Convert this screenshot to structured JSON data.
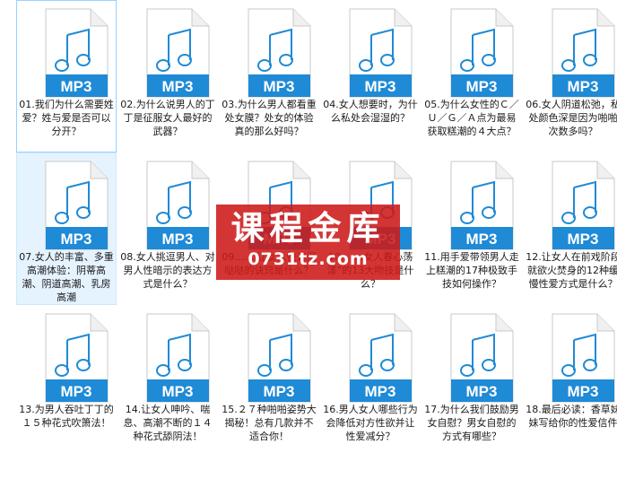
{
  "files": [
    {
      "name": "01.我们为什么需要姓爱？姓与爱是否可以分开？",
      "ext": "MP3"
    },
    {
      "name": "02.为什么说男人的丁丁是征服女人最好的武器？",
      "ext": "MP3"
    },
    {
      "name": "03.为什么男人都看重处女膜？处女的体验真的那么好吗？",
      "ext": "MP3"
    },
    {
      "name": "04.女人想要时，为什么私处会湿湿的？",
      "ext": "MP3"
    },
    {
      "name": "05.为什么女性的Ｃ／Ｕ／Ｇ／Ａ点为最易获取糕潮的４大点？",
      "ext": "MP3"
    },
    {
      "name": "06.女人阴道松弛，私处颜色深是因为啪啪次数多吗？",
      "ext": "MP3"
    },
    {
      "name": "07.女人的丰富、多重高潮体验：阴蒂高潮、阴道高潮、乳房高潮",
      "ext": "MP3"
    },
    {
      "name": "08.女人挑逗男人、对男人性暗示的表达方式是什么？",
      "ext": "MP3"
    },
    {
      "name": "09.……让女人快速湿哒哒的诀窍是什么？",
      "ext": "MP3"
    },
    {
      "name": "10.……女人春心荡漾”的13大吻技是什么？",
      "ext": "MP3"
    },
    {
      "name": "11.用手爱带领男人走上糕潮的17种极致手技如何操作？",
      "ext": "MP3"
    },
    {
      "name": "12.让女人在前戏阶段就欲火焚身的12种缓慢性爱方式是什么？",
      "ext": "MP3"
    },
    {
      "name": "13.为男人吞吐丁丁的１５种花式吹箫法！",
      "ext": "MP3"
    },
    {
      "name": "14.让女人呻吟、喘息、高潮不断的１４种花式舔阴法！",
      "ext": "MP3"
    },
    {
      "name": "15.２７种啪啪姿势大揭秘！总有几款并不适合你！",
      "ext": "MP3"
    },
    {
      "name": "16.男人女人哪些行为会降低对方性欲并让性爱减分？",
      "ext": "MP3"
    },
    {
      "name": "17.为什么我们鼓励男女自慰？男女自慰的方式有哪些？",
      "ext": "MP3"
    },
    {
      "name": "18.最后必读：香草妹妹写给你的性爱信件",
      "ext": "MP3"
    }
  ],
  "selected_index": 6,
  "focus_index": 0,
  "watermark": {
    "title": "课程金库",
    "url": "0731tz.com"
  },
  "colors": {
    "badge": "#1f8ad6",
    "glyph": "#1f8ad6",
    "watermark_bg": "#cd1919"
  }
}
